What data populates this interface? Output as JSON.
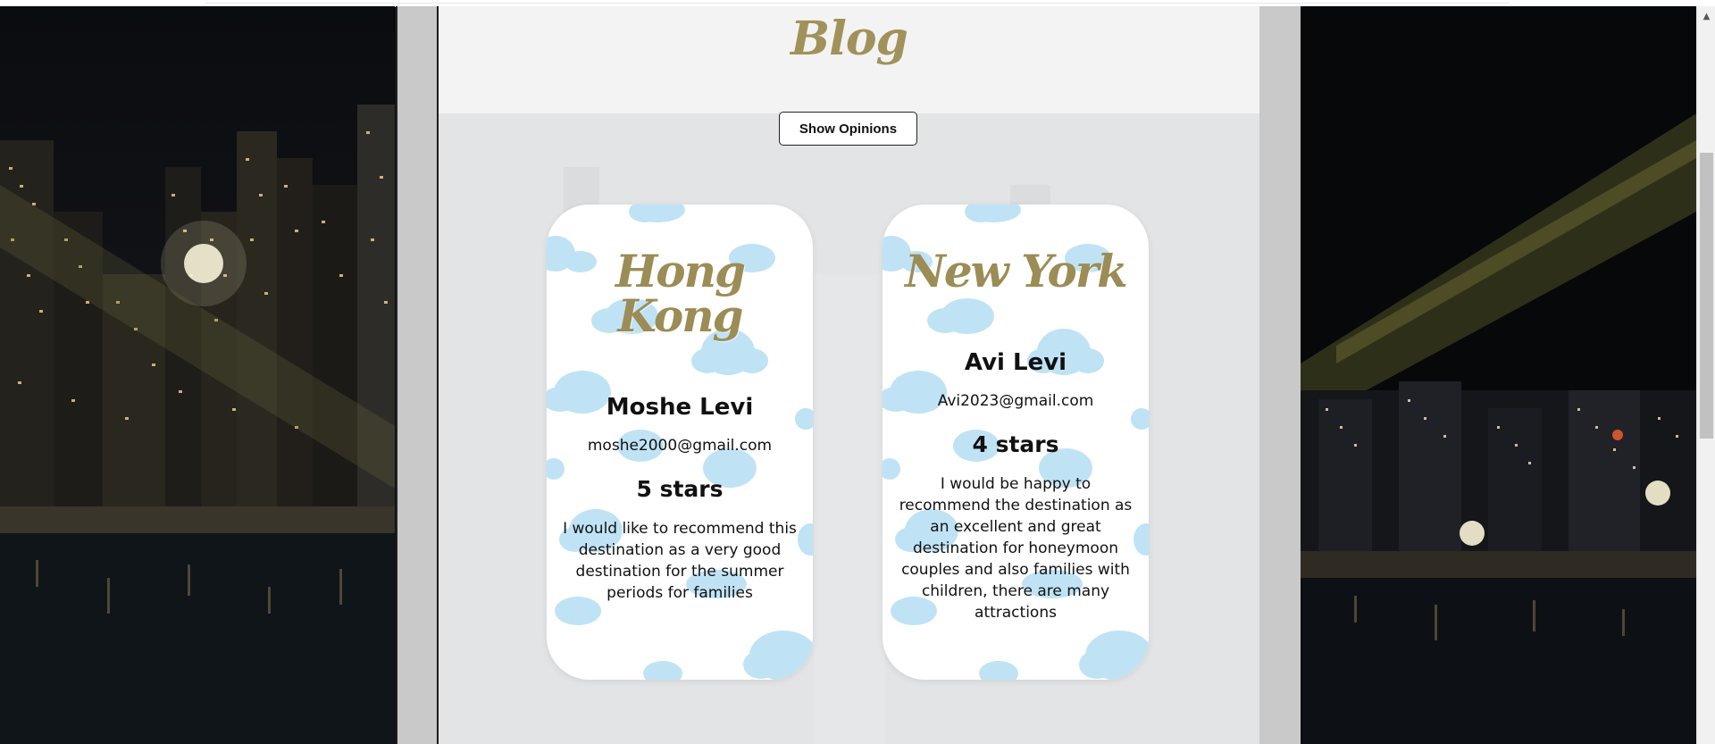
{
  "page": {
    "title": "Blog"
  },
  "actions": {
    "show_opinions_label": "Show Opinions"
  },
  "cards": [
    {
      "city": "Hong Kong",
      "name": "Moshe Levi",
      "email": "moshe2000@gmail.com",
      "rating": "5 stars",
      "opinion": "I would like to recommend this destination as a very good destination for the summer periods for families"
    },
    {
      "city": "New York",
      "name": "Avi Levi",
      "email": "Avi2023@gmail.com",
      "rating": "4 stars",
      "opinion": "I would be happy to recommend the destination as an excellent and great destination for honeymoon couples and also families with children, there are many attractions"
    }
  ],
  "colors": {
    "title_gold": "#a1925b",
    "card_bg": "#ffffff",
    "cloud": "#bfe3f5",
    "content_bg": "#f3f3f3"
  },
  "icons": {
    "scroll_up": "scroll-up-arrow-icon"
  }
}
